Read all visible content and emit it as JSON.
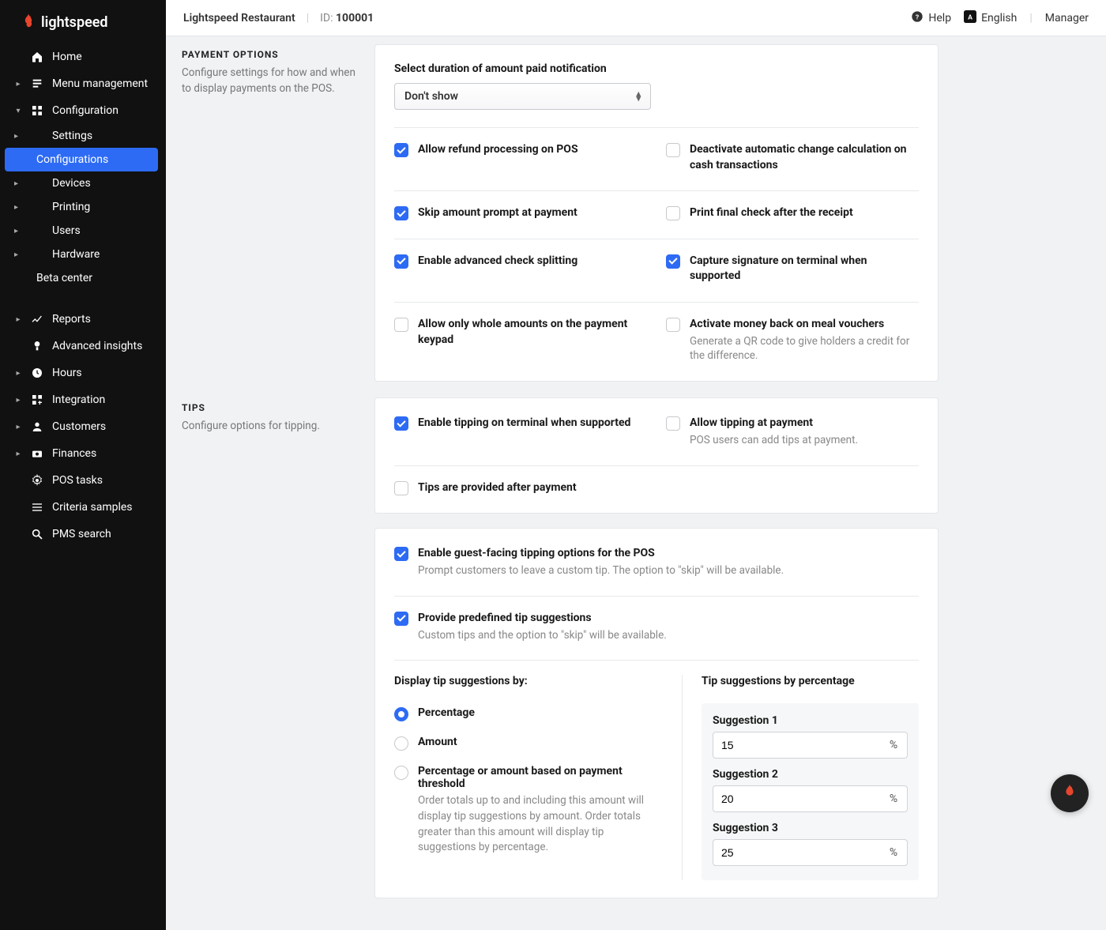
{
  "brand": {
    "name": "lightspeed"
  },
  "topbar": {
    "restaurant": "Lightspeed Restaurant",
    "id_label": "ID:",
    "id_value": "100001",
    "help": "Help",
    "language": "English",
    "role": "Manager"
  },
  "sidebar": {
    "items": [
      {
        "label": "Home",
        "icon": "home",
        "chev": ""
      },
      {
        "label": "Menu management",
        "icon": "menu",
        "chev": "▸"
      },
      {
        "label": "Configuration",
        "icon": "config",
        "chev": "▾",
        "sub": [
          {
            "label": "Settings",
            "active": false,
            "chev": "▸"
          },
          {
            "label": "Configurations",
            "active": true
          },
          {
            "label": "Devices",
            "active": false,
            "chev": "▸"
          },
          {
            "label": "Printing",
            "active": false,
            "chev": "▸"
          },
          {
            "label": "Users",
            "active": false,
            "chev": "▸"
          },
          {
            "label": "Hardware",
            "active": false,
            "chev": "▸"
          },
          {
            "label": "Beta center",
            "active": false
          }
        ]
      },
      {
        "label": "Reports",
        "icon": "reports",
        "chev": "▸"
      },
      {
        "label": "Advanced insights",
        "icon": "insights",
        "chev": ""
      },
      {
        "label": "Hours",
        "icon": "clock",
        "chev": "▸"
      },
      {
        "label": "Integration",
        "icon": "integration",
        "chev": "▸"
      },
      {
        "label": "Customers",
        "icon": "customers",
        "chev": "▸"
      },
      {
        "label": "Finances",
        "icon": "finances",
        "chev": "▸"
      },
      {
        "label": "POS tasks",
        "icon": "gear",
        "chev": ""
      },
      {
        "label": "Criteria samples",
        "icon": "list",
        "chev": ""
      },
      {
        "label": "PMS search",
        "icon": "search",
        "chev": ""
      }
    ]
  },
  "section1": {
    "title": "PAYMENT OPTIONS",
    "desc": "Configure settings for how and when to display payments on the POS.",
    "durationLabel": "Select duration of amount paid notification",
    "durationValue": "Don't show",
    "rows": [
      {
        "left": {
          "label": "Allow refund processing on POS",
          "checked": true
        },
        "right": {
          "label": "Deactivate automatic change calculation on cash transactions",
          "checked": false
        }
      },
      {
        "left": {
          "label": "Skip amount prompt at payment",
          "checked": true
        },
        "right": {
          "label": "Print final check after the receipt",
          "checked": false
        }
      },
      {
        "left": {
          "label": "Enable advanced check splitting",
          "checked": true
        },
        "right": {
          "label": "Capture signature on terminal when supported",
          "checked": true
        }
      },
      {
        "left": {
          "label": "Allow only whole amounts on the payment keypad",
          "checked": false
        },
        "right": {
          "label": "Activate money back on meal vouchers",
          "sub": "Generate a QR code to give holders a credit for the difference.",
          "checked": false
        }
      }
    ]
  },
  "section2": {
    "title": "TIPS",
    "desc": "Configure options for tipping.",
    "card1rows": [
      {
        "left": {
          "label": "Enable tipping on terminal when supported",
          "checked": true
        },
        "right": {
          "label": "Allow tipping at payment",
          "sub": "POS users can add tips at payment.",
          "checked": false
        }
      },
      {
        "left": {
          "label": "Tips are provided after payment",
          "checked": false
        }
      }
    ],
    "card2": {
      "opt1": {
        "label": "Enable guest-facing tipping options for the POS",
        "sub": "Prompt customers to leave a custom tip. The option to \"skip\" will be available.",
        "checked": true
      },
      "opt2": {
        "label": "Provide predefined tip suggestions",
        "sub": "Custom tips and the option to \"skip\" will be available.",
        "checked": true
      },
      "displayByLabel": "Display tip suggestions by:",
      "radios": [
        {
          "label": "Percentage",
          "selected": true
        },
        {
          "label": "Amount",
          "selected": false
        },
        {
          "label": "Percentage or amount based on payment threshold",
          "sub": "Order totals up to and including this amount will display tip suggestions by amount. Order totals greater than this amount will display tip suggestions by percentage.",
          "selected": false
        }
      ],
      "rightTitle": "Tip suggestions by percentage",
      "suggestions": [
        {
          "label": "Suggestion 1",
          "value": "15"
        },
        {
          "label": "Suggestion 2",
          "value": "20"
        },
        {
          "label": "Suggestion 3",
          "value": "25"
        }
      ],
      "percentSymbol": "%"
    }
  }
}
